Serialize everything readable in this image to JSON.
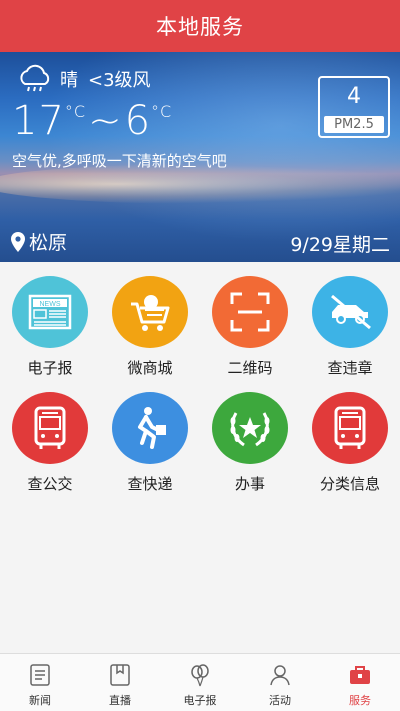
{
  "header": {
    "title": "本地服务"
  },
  "weather": {
    "condition": "晴",
    "wind": "<3级风",
    "temp_high": "17",
    "temp_low": "6",
    "deg_unit": "°C",
    "tilde": "~",
    "quality_text": "空气优,多呼吸一下清新的空气吧",
    "pm_value": "4",
    "pm_label": "PM2.5",
    "location": "松原",
    "date": "9/29星期二",
    "icons": {
      "condition": "cloud-rain-icon",
      "location": "location-pin-icon"
    }
  },
  "services": [
    {
      "label": "电子报",
      "icon": "newspaper-icon",
      "color": "#4fc3d8"
    },
    {
      "label": "微商城",
      "icon": "shopping-cart-icon",
      "color": "#f2a312"
    },
    {
      "label": "二维码",
      "icon": "qr-scan-icon",
      "color": "#f26a35"
    },
    {
      "label": "查违章",
      "icon": "no-car-icon",
      "color": "#3db3e6"
    },
    {
      "label": "查公交",
      "icon": "bus-icon",
      "color": "#e13a3a"
    },
    {
      "label": "查快递",
      "icon": "courier-runner-icon",
      "color": "#3d8fe0"
    },
    {
      "label": "办事",
      "icon": "star-laurel-icon",
      "color": "#3da83d"
    },
    {
      "label": "分类信息",
      "icon": "bus-icon",
      "color": "#e13a3a"
    }
  ],
  "tabbar": {
    "tabs": [
      {
        "label": "新闻",
        "icon": "news-doc-icon",
        "active": false
      },
      {
        "label": "直播",
        "icon": "bookmark-icon",
        "active": false
      },
      {
        "label": "电子报",
        "icon": "balloon-icon",
        "active": false
      },
      {
        "label": "活动",
        "icon": "person-icon",
        "active": false
      },
      {
        "label": "服务",
        "icon": "briefcase-icon",
        "active": true
      }
    ],
    "active_color": "#e04346"
  }
}
